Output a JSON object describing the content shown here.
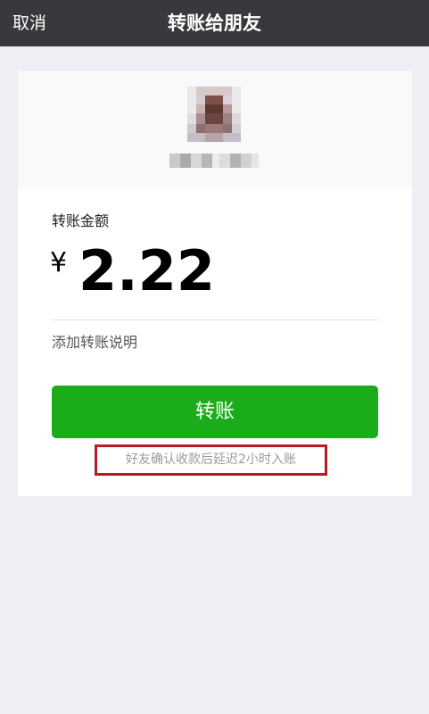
{
  "nav": {
    "cancel_label": "取消",
    "title": "转账给朋友"
  },
  "transfer": {
    "amount_label": "转账金额",
    "currency_symbol": "¥",
    "amount": "2.22",
    "add_note_label": "添加转账说明",
    "button_label": "转账",
    "delay_notice": "好友确认收款后延迟2小时入账"
  },
  "colors": {
    "nav_background": "#39383d",
    "button_green": "#1aad19",
    "highlight_red": "#b81c22",
    "page_background": "#efeef4"
  }
}
